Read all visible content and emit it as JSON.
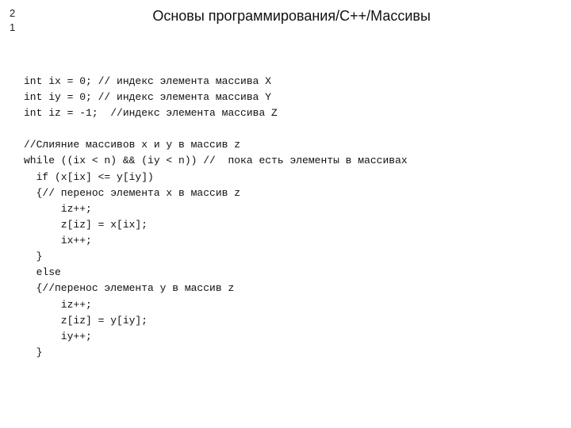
{
  "header": {
    "page_num_top": "2",
    "page_num_bottom": "1",
    "title": "Основы программирования/С++/Массивы"
  },
  "code": {
    "lines": [
      "int ix = 0; // индекс элемента массива X",
      "int iy = 0; // индекс элемента массива Y",
      "int iz = -1;  //индекс элемента массива Z",
      "",
      "//Слияние массивов x и y в массив z",
      "while ((ix < n) && (iy < n)) //  пока есть элементы в массивах",
      "  if (x[ix] <= y[iy])",
      "  {// перенос элемента x в массив z",
      "      iz++;",
      "      z[iz] = x[ix];",
      "      ix++;",
      "  }",
      "  else",
      "  {//перенос элемента y в массив z",
      "      iz++;",
      "      z[iz] = y[iy];",
      "      iy++;",
      "  }"
    ]
  }
}
